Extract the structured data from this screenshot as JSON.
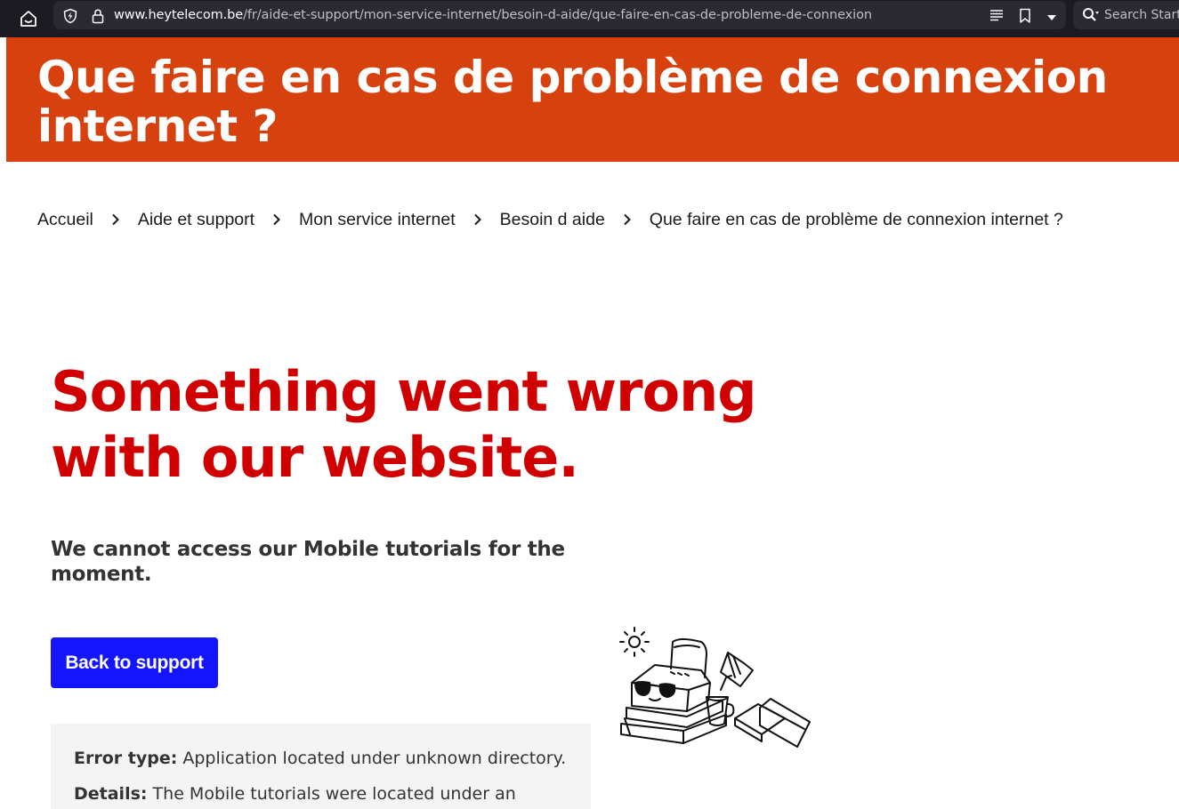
{
  "browser": {
    "url_domain": "www.heytelecom.be",
    "url_path": "/fr/aide-et-support/mon-service-internet/besoin-d-aide/que-faire-en-cas-de-probleme-de-connexion",
    "search_placeholder": "Search Start"
  },
  "hero": {
    "title": "Que faire en cas de problème de connexion internet ?",
    "background_color": "#d7410e"
  },
  "breadcrumb": [
    "Accueil",
    "Aide et support",
    "Mon service internet",
    "Besoin d aide",
    "Que faire en cas de problème de connexion internet ?"
  ],
  "error": {
    "title_line1": "Something went wrong",
    "title_line2": "with our website.",
    "subtitle": "We cannot access our Mobile tutorials for the moment.",
    "title_color": "#d10000",
    "button_label": "Back to support",
    "button_color": "#1414ff",
    "error_type_label": "Error type:",
    "error_type_value": "Application located under unknown directory.",
    "details_label": "Details:",
    "details_value": "The Mobile tutorials were located under an"
  },
  "icons": {
    "home": "home-icon",
    "shield": "tracking-protection-shield-icon",
    "lock": "lock-icon",
    "reader": "reader-view-icon",
    "bookmark": "bookmark-icon",
    "dropdown": "chevron-down-icon",
    "search": "search-icon",
    "separator": "chevron-right-icon",
    "illustration": "relaxing-router-illustration"
  }
}
